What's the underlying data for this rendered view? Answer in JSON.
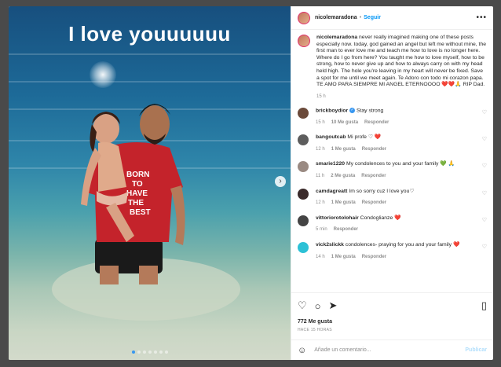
{
  "media": {
    "overlay_text": "I love youuuuuu",
    "next_icon": "chevron-right-icon",
    "dots_count": 7,
    "active_dot": 0
  },
  "header": {
    "username": "nicolemaradona",
    "separator": "•",
    "follow_label": "Seguir",
    "more_icon": "more-horizontal-icon"
  },
  "caption": {
    "username": "nicolemaradona",
    "text": "never really imagined making one of these posts especially now. today, god gained an angel but left me without mine, the first man to ever love me and teach me how to love is no longer here. Where do I go from here? You taught me how to love myself, how to be strong, how to never give up and how to always carry on with my head held high. The hole you're leaving in my heart will never be fixed. Save a spot for me until we meet again. Te Adoro con todo mi corazon papa. TE AMO PARA SIEMPRE MI ANGEL ETERNOOOO ❤️❤️🙏 RIP Dad.",
    "time": "15 h"
  },
  "comments": [
    {
      "username": "brickboydior",
      "verified": true,
      "text": "Stay strong",
      "time": "15 h",
      "likes": "10 Me gusta",
      "reply": "Responder",
      "avatar_color": "#6b4a3a"
    },
    {
      "username": "bangoutcab",
      "verified": false,
      "text": "Mi profe ♡ ❤️",
      "time": "12 h",
      "likes": "1 Me gusta",
      "reply": "Responder",
      "avatar_color": "#5d5d5d"
    },
    {
      "username": "smarie1220",
      "verified": false,
      "text": "My condolences to you and your family 💚 🙏",
      "time": "11 h",
      "likes": "2 Me gusta",
      "reply": "Responder",
      "avatar_color": "#9a8a82"
    },
    {
      "username": "camdagreatt",
      "verified": false,
      "text": "Im so sorry cuz I love you♡",
      "time": "12 h",
      "likes": "1 Me gusta",
      "reply": "Responder",
      "avatar_color": "#3a2a2a"
    },
    {
      "username": "vittoriorotolohair",
      "verified": false,
      "text": "Condoglianze ❤️",
      "time": "5 min",
      "likes": "",
      "reply": "Responder",
      "avatar_color": "#444444"
    },
    {
      "username": "vick2slickk",
      "verified": false,
      "text": "condolences- praying for you and your family ❤️",
      "time": "14 h",
      "likes": "1 Me gusta",
      "reply": "Responder",
      "avatar_color": "#2dc1d6"
    }
  ],
  "actions": {
    "like_icon": "heart-icon",
    "comment_icon": "comment-icon",
    "share_icon": "send-icon",
    "save_icon": "bookmark-icon",
    "likes_count": "772 Me gusta",
    "posted_ago": "HACE 15 HORAS"
  },
  "composer": {
    "emoji_icon": "smiley-icon",
    "placeholder": "Añade un comentario...",
    "post_label": "Publicar"
  },
  "colors": {
    "link_blue": "#0095f6",
    "verified_blue": "#3897f0",
    "heart_red": "#ed4956",
    "muted": "#8e8e8e"
  }
}
